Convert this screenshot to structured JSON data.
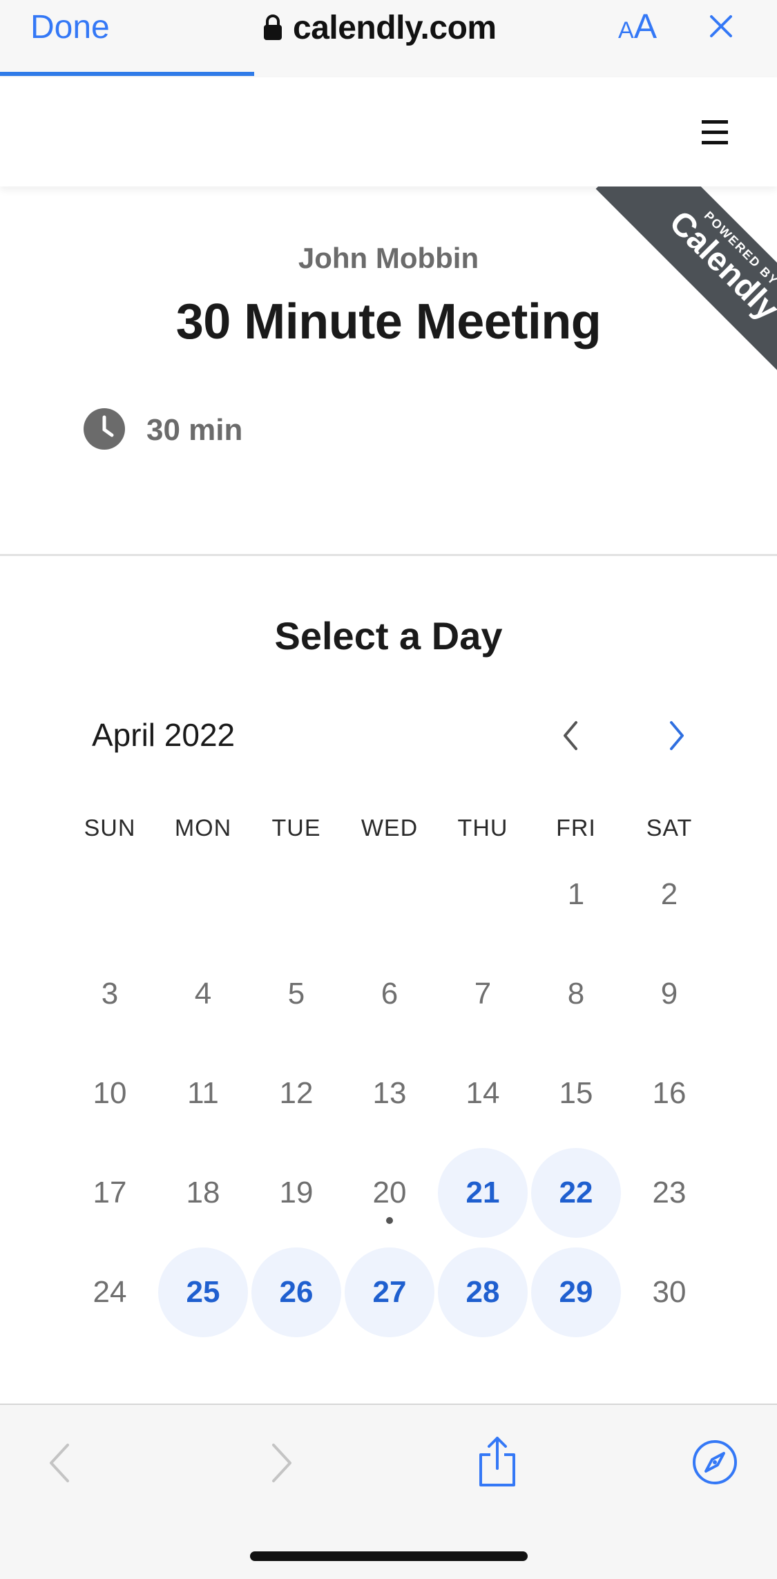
{
  "browser": {
    "done_label": "Done",
    "url": "calendly.com",
    "text_size_small": "A",
    "text_size_large": "A",
    "accent": "#3478f6",
    "progress_percent": 33
  },
  "ribbon": {
    "line1": "POWERED BY",
    "line2": "Calendly"
  },
  "event": {
    "host": "John Mobbin",
    "title": "30 Minute Meeting",
    "duration": "30 min"
  },
  "calendar": {
    "heading": "Select a Day",
    "month": "April 2022",
    "weekdays": [
      "SUN",
      "MON",
      "TUE",
      "WED",
      "THU",
      "FRI",
      "SAT"
    ],
    "weeks": [
      [
        "",
        "",
        "",
        "",
        "",
        "1",
        "2"
      ],
      [
        "3",
        "4",
        "5",
        "6",
        "7",
        "8",
        "9"
      ],
      [
        "10",
        "11",
        "12",
        "13",
        "14",
        "15",
        "16"
      ],
      [
        "17",
        "18",
        "19",
        "20",
        "21",
        "22",
        "23"
      ],
      [
        "24",
        "25",
        "26",
        "27",
        "28",
        "29",
        "30"
      ]
    ],
    "available_days": [
      "21",
      "22",
      "25",
      "26",
      "27",
      "28",
      "29"
    ],
    "today": "20",
    "available_color": "#1f5fcf",
    "available_bg": "#eef3fd"
  },
  "icons": {
    "lock": "lock-icon",
    "close": "close-icon",
    "menu": "hamburger-menu-icon",
    "clock": "clock-icon",
    "prev_month": "chevron-left-icon",
    "next_month": "chevron-right-icon",
    "back": "back-arrow-icon",
    "forward": "forward-arrow-icon",
    "share": "share-icon",
    "compass": "compass-icon"
  }
}
